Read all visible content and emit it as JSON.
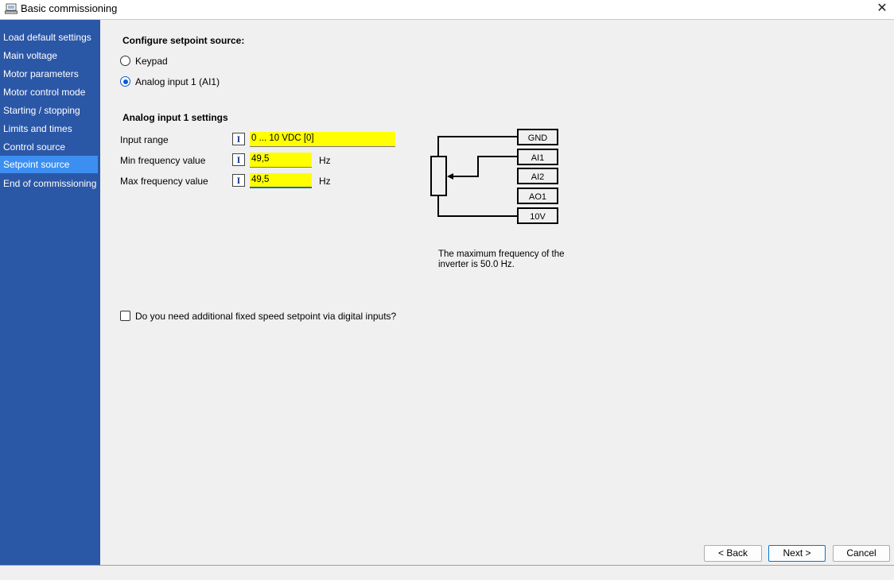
{
  "window": {
    "title": "Basic commissioning",
    "close_glyph": "✕"
  },
  "sidebar": {
    "items": [
      {
        "label": "Load default settings"
      },
      {
        "label": "Main voltage"
      },
      {
        "label": "Motor parameters"
      },
      {
        "label": "Motor control mode"
      },
      {
        "label": "Starting / stopping"
      },
      {
        "label": "Limits and times"
      },
      {
        "label": "Control source"
      },
      {
        "label": "Setpoint source",
        "active": true
      },
      {
        "label": "End of commissioning"
      }
    ],
    "background": "#2b57a7",
    "active_background": "#3c8ff0"
  },
  "setpoint": {
    "heading": "Configure setpoint source:",
    "options": [
      {
        "label": "Keypad",
        "selected": false
      },
      {
        "label": "Analog input 1 (AI1)",
        "selected": true
      }
    ]
  },
  "ai_settings": {
    "heading": "Analog input  1 settings",
    "rows": [
      {
        "label": "Input range",
        "value": "0 ... 10 VDC [0]",
        "unit": ""
      },
      {
        "label": "Min frequency value",
        "value": "49,5",
        "unit": "Hz"
      },
      {
        "label": "Max frequency value",
        "value": "49,5",
        "unit": "Hz"
      }
    ],
    "icon_glyph": "I",
    "highlight_color": "#ffff00"
  },
  "diagram": {
    "terminals": [
      "GND",
      "AI1",
      "AI2",
      "AO1",
      "10V"
    ],
    "note_line1": "The maximum frequency of the",
    "note_line2": "inverter is 50.0 Hz."
  },
  "fixed_speed": {
    "label": "Do you need additional fixed speed setpoint via digital inputs?",
    "checked": false
  },
  "footer": {
    "back_label": "< Back",
    "next_label": "Next >",
    "cancel_label": "Cancel"
  }
}
